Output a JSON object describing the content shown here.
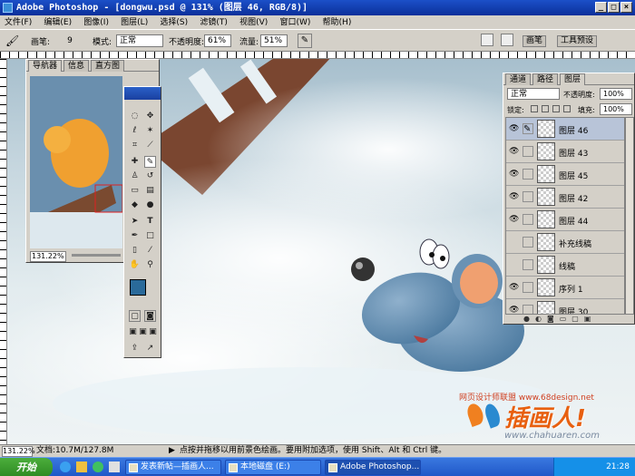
{
  "window": {
    "title": "Adobe Photoshop - [dongwu.psd @ 131% (图层 46, RGB/8)]",
    "controls": [
      "_",
      "□",
      "×"
    ]
  },
  "menu": [
    "文件(F)",
    "编辑(E)",
    "图像(I)",
    "图层(L)",
    "选择(S)",
    "滤镜(T)",
    "视图(V)",
    "窗口(W)",
    "帮助(H)"
  ],
  "options": {
    "brush_label": "画笔:",
    "brush_size": "9",
    "mode_label": "模式:",
    "mode_value": "正常",
    "opacity_label": "不透明度:",
    "opacity_value": "61%",
    "flow_label": "流量:",
    "flow_value": "51%",
    "right_tabs": [
      "画笔",
      "工具预设"
    ]
  },
  "navigator": {
    "tabs": [
      "导航器",
      "信息",
      "直方图"
    ],
    "zoom": "131.22%"
  },
  "layers": {
    "tabs": [
      "通道",
      "路径",
      "图层"
    ],
    "blend_mode": "正常",
    "opacity_label": "不透明度:",
    "opacity_value": "100%",
    "lock_label": "锁定:",
    "fill_label": "填充:",
    "fill_value": "100%",
    "items": [
      {
        "name": "图层 46",
        "visible": true,
        "selected": true
      },
      {
        "name": "图层 43",
        "visible": true,
        "selected": false
      },
      {
        "name": "图层 45",
        "visible": true,
        "selected": false
      },
      {
        "name": "图层 42",
        "visible": true,
        "selected": false
      },
      {
        "name": "图层 44",
        "visible": true,
        "selected": false
      },
      {
        "name": "补充线稿",
        "visible": false,
        "selected": false
      },
      {
        "name": "线稿",
        "visible": false,
        "selected": false
      },
      {
        "name": "序列 1",
        "visible": true,
        "selected": false
      },
      {
        "name": "图层 30",
        "visible": true,
        "selected": false
      }
    ]
  },
  "watermark": {
    "line1": "网页设计师联盟 www.68design.net",
    "logo": "插画人!",
    "url": "www.chahuaren.com"
  },
  "status": {
    "zoom": "131.22%",
    "doc": "文档:10.7M/127.8M",
    "hint": "点按并拖移以用前景色绘画。要用附加选项，使用 Shift、Alt 和 Ctrl 键。"
  },
  "taskbar": {
    "start": "开始",
    "buttons": [
      "发表新帖—插画人...",
      "本地磁盘 (E:)",
      "Adobe Photoshop..."
    ],
    "time": "21:28"
  },
  "colors": {
    "foreground": "#2a6a9a",
    "background": "#ffffff"
  }
}
